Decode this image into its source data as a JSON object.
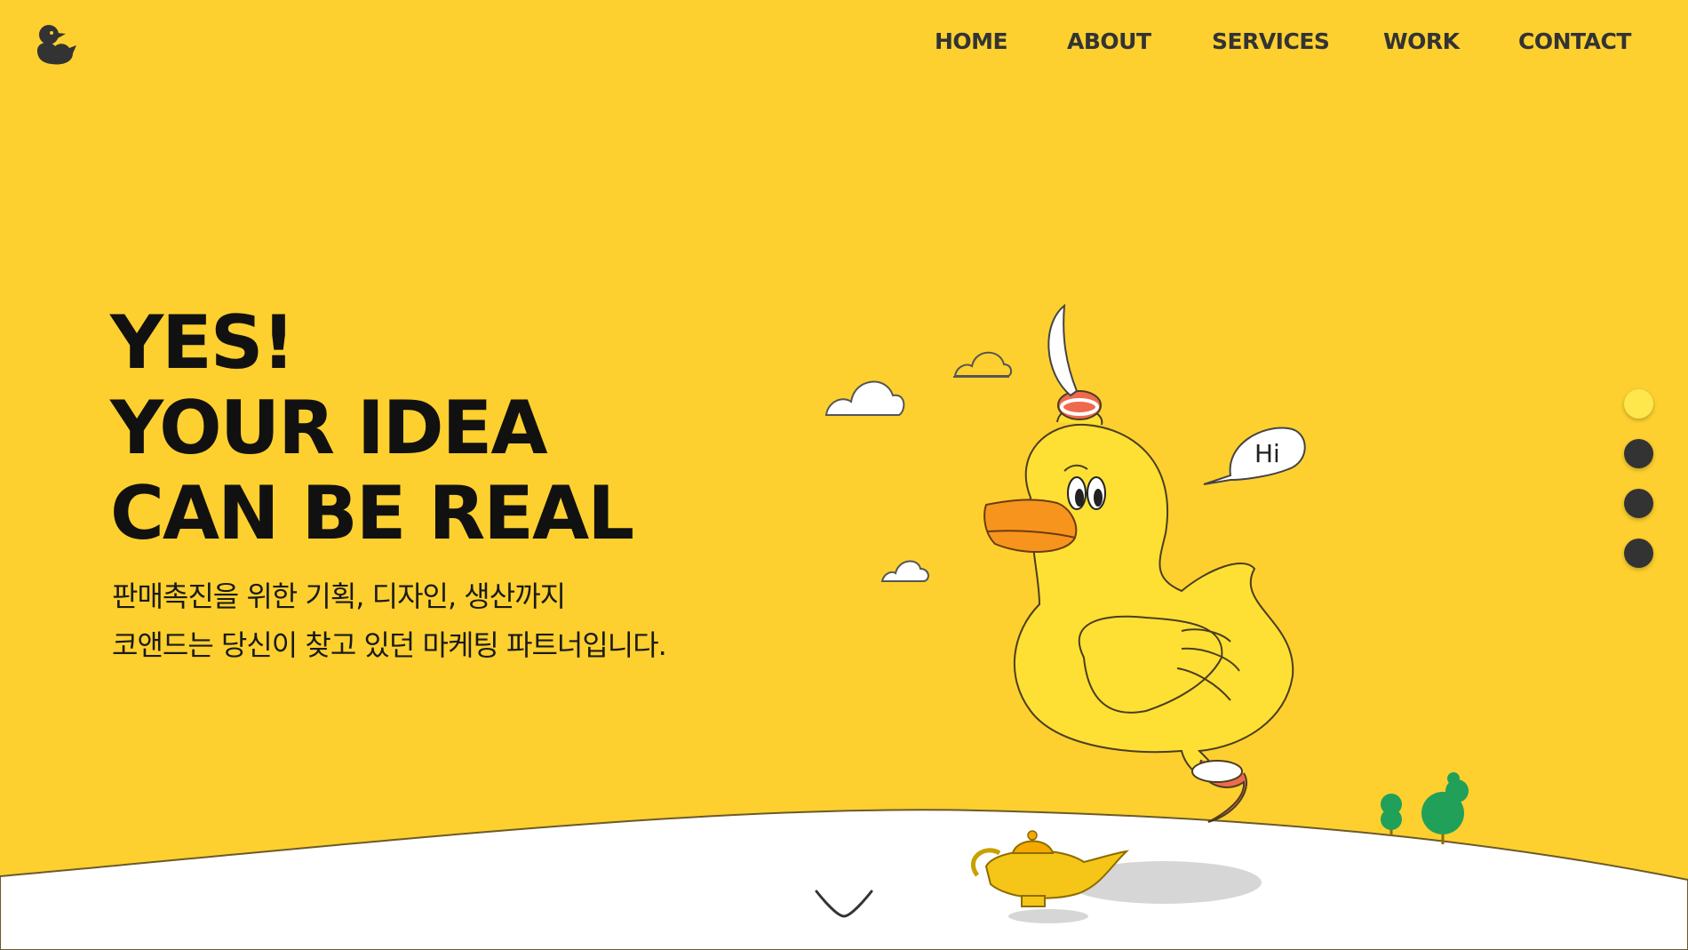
{
  "brand": {
    "logo_icon": "duck-logo-icon"
  },
  "nav": {
    "items": [
      {
        "label": "HOME"
      },
      {
        "label": "ABOUT"
      },
      {
        "label": "SERVICES"
      },
      {
        "label": "WORK"
      },
      {
        "label": "CONTACT"
      }
    ]
  },
  "hero": {
    "headline": [
      "YES!",
      "YOUR IDEA",
      "CAN BE REAL"
    ],
    "subtext": [
      "판매촉진을 위한 기획, 디자인, 생산까지",
      "코앤드는 당신이 찾고 있던 마케팅 파트너입니다."
    ],
    "speech_bubble": "Hi",
    "background_color": "#fdd02f",
    "ground_color": "#ffffff"
  },
  "pager": {
    "count": 4,
    "active_index": 0,
    "active_color": "#fde74c",
    "inactive_color": "#333333"
  },
  "scroll": {
    "icon": "chevron-down-icon"
  }
}
